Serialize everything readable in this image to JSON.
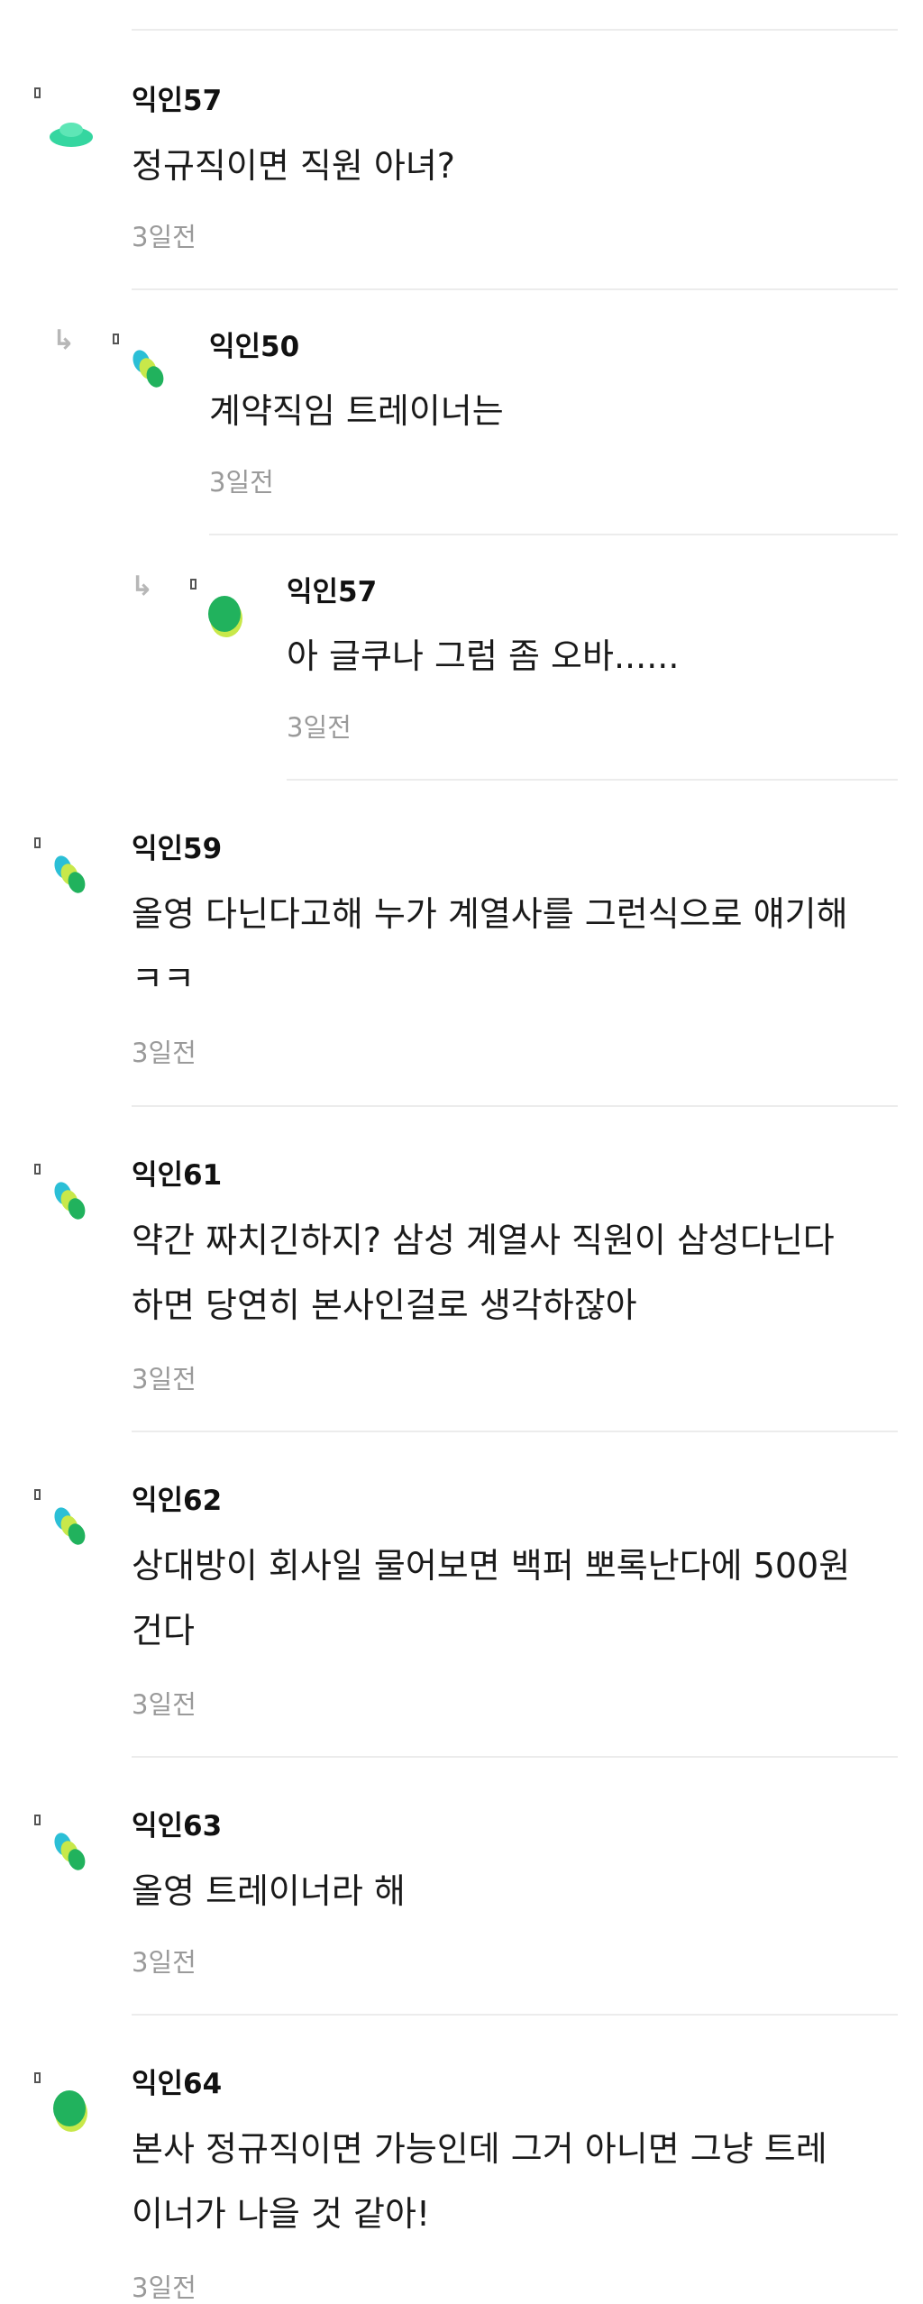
{
  "comments": [
    {
      "author": "익인57",
      "lines": [
        "정규직이면 직원 아녀?"
      ],
      "time": "3일전",
      "avatar": "mint-cap"
    },
    {
      "author": "익인50",
      "lines": [
        "계약직임 트레이너는"
      ],
      "time": "3일전",
      "avatar": "tricolor-blobs",
      "reply": true
    },
    {
      "author": "익인57",
      "lines": [
        "아 글쿠나 그럼 좀 오바......"
      ],
      "time": "3일전",
      "avatar": "green-oval",
      "reply": true
    },
    {
      "author": "익인59",
      "lines": [
        "올영 다닌다고해 누가 계열사를 그런식으로 얘기해",
        "ㅋㅋ"
      ],
      "time": "3일전",
      "avatar": "tricolor-blobs"
    },
    {
      "author": "익인61",
      "lines": [
        "약간 짜치긴하지? 삼성 계열사 직원이 삼성다닌다",
        "하면 당연히 본사인걸로 생각하잖아"
      ],
      "time": "3일전",
      "avatar": "tricolor-blobs"
    },
    {
      "author": "익인62",
      "lines": [
        "상대방이 회사일 물어보면 백퍼 뽀록난다에 500원",
        "건다"
      ],
      "time": "3일전",
      "avatar": "tricolor-blobs"
    },
    {
      "author": "익인63",
      "lines": [
        "올영 트레이너라 해"
      ],
      "time": "3일전",
      "avatar": "tricolor-blobs"
    },
    {
      "author": "익인64",
      "lines": [
        "본사 정규직이면 가능인데 그거 아니면 그냥 트레",
        "이너가 나을 것 같아!"
      ],
      "time": "3일전",
      "avatar": "green-oval"
    }
  ],
  "icons": {
    "reply": "reply-arrow-icon",
    "anon_marker": "anon-marker-icon"
  },
  "colors": {
    "accent_green": "#21b25d",
    "mint": "#35d6a0",
    "teal": "#2bbfd6",
    "lime": "#c8e84a",
    "muted_text": "#9a9a9a"
  }
}
